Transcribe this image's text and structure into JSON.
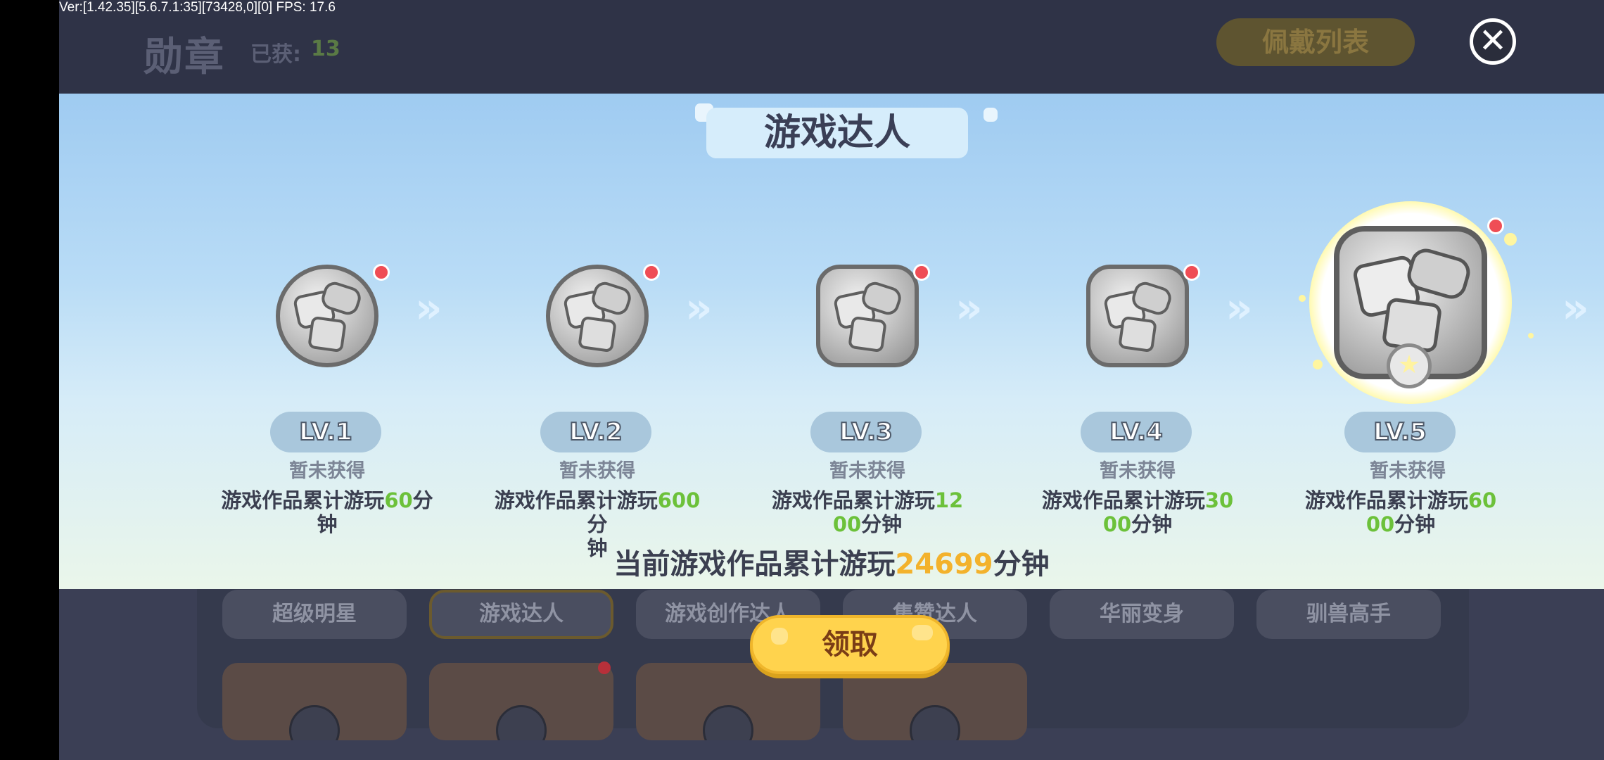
{
  "debug": {
    "version_text": "Ver:[1.42.35][5.6.7.1:35][73428,0][0] FPS: 17.6"
  },
  "background": {
    "title": "勋章",
    "count_label": "已获:",
    "count_value": "13",
    "wear_list_label": "佩戴列表",
    "tabs": [
      "超级明星",
      "游戏达人",
      "游戏创作达人",
      "集赞达人",
      "华丽变身",
      "驯兽高手"
    ]
  },
  "close_icon": "close-icon",
  "modal": {
    "title": "游戏达人",
    "levels": [
      {
        "label": "LV.1",
        "status": "暂未获得",
        "desc_prefix": "游戏作品累计游玩",
        "desc_num_1": "60",
        "desc_mid": "分",
        "desc_num_2": "",
        "desc_suffix": "钟"
      },
      {
        "label": "LV.2",
        "status": "暂未获得",
        "desc_prefix": "游戏作品累计游玩",
        "desc_num_1": "600",
        "desc_mid": "分",
        "desc_num_2": "",
        "desc_suffix": "钟"
      },
      {
        "label": "LV.3",
        "status": "暂未获得",
        "desc_prefix": "游戏作品累计游玩",
        "desc_num_1": "12",
        "desc_mid": "",
        "desc_num_2": "00",
        "desc_suffix": "分钟"
      },
      {
        "label": "LV.4",
        "status": "暂未获得",
        "desc_prefix": "游戏作品累计游玩",
        "desc_num_1": "30",
        "desc_mid": "",
        "desc_num_2": "00",
        "desc_suffix": "分钟"
      },
      {
        "label": "LV.5",
        "status": "暂未获得",
        "desc_prefix": "游戏作品累计游玩",
        "desc_num_1": "60",
        "desc_mid": "",
        "desc_num_2": "00",
        "desc_suffix": "分钟"
      }
    ],
    "total_prefix": "当前游戏作品累计游玩",
    "total_value": "24699",
    "total_suffix": "分钟",
    "claim_label": "领取"
  },
  "colors": {
    "accent_green": "#6cc13a",
    "accent_orange": "#f3b22c",
    "claim_yellow": "#ffd34d",
    "red_dot": "#ef4d55"
  }
}
